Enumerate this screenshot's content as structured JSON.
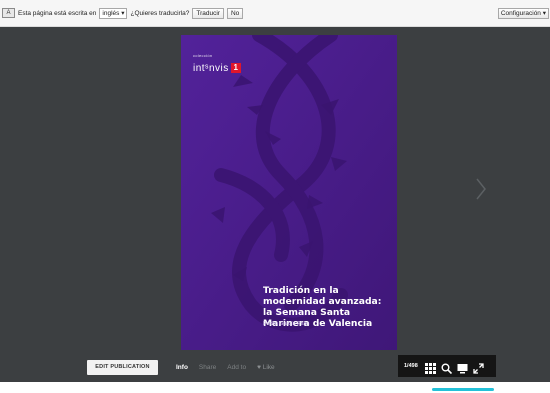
{
  "translate_bar": {
    "prompt": "Esta página está escrita en",
    "language": "inglés",
    "question": "¿Quieres traducirla?",
    "translate_button": "Traducir",
    "no_button": "No",
    "settings_button": "Configuración"
  },
  "publication": {
    "brand_prefix": "colección",
    "brand_name": "intˢnvis",
    "brand_number": "1",
    "title": "Tradición en la modernidad avanzada: la Semana Santa Marinera de Valencia",
    "author": "Pedro García Pilán"
  },
  "controls": {
    "edit_publication": "EDIT PUBLICATION",
    "info": "Info",
    "share": "Share",
    "add_to": "Add to",
    "like": "♥ Like",
    "page_indicator": "1/498"
  },
  "colors": {
    "reader_background": "#3c3f41",
    "cover_purple": "#4a1e8a",
    "brand_red": "#e0162b",
    "footer_accent": "#23c1d8"
  },
  "icons": [
    "translate-icon",
    "next-page-icon",
    "grid-icon",
    "search-icon",
    "share-screen-icon",
    "fullscreen-icon"
  ]
}
